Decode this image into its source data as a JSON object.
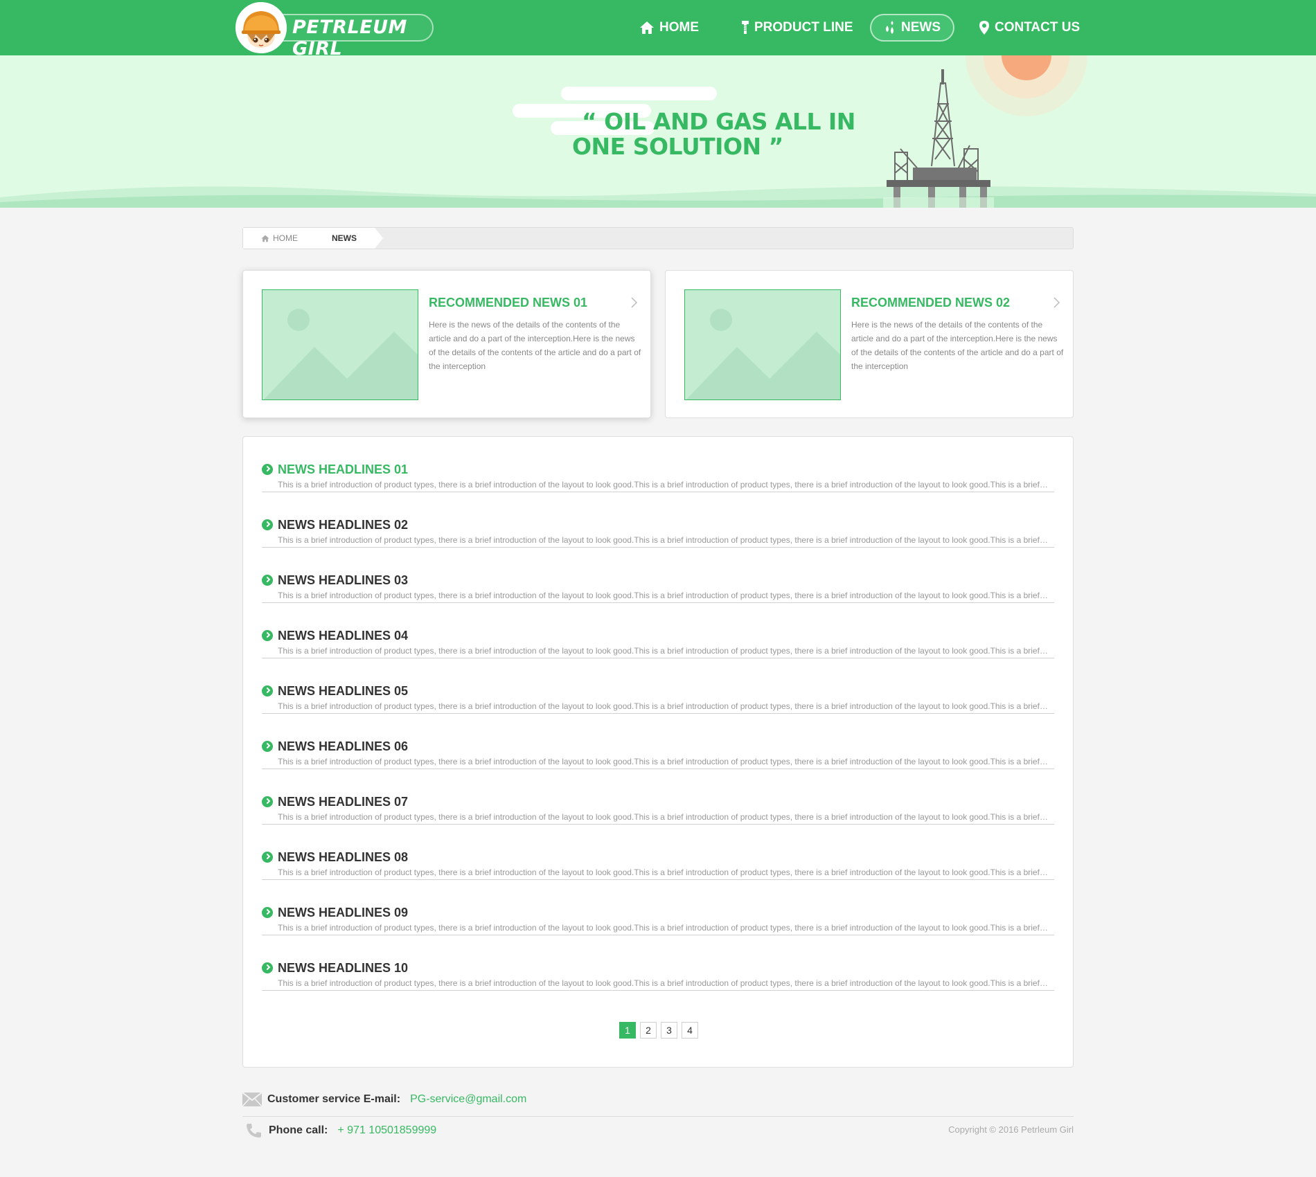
{
  "brand": {
    "name": "PETRLEUM GIRL",
    "accent": "#37b862"
  },
  "nav": {
    "items": [
      {
        "label": "HOME",
        "icon": "home-icon"
      },
      {
        "label": "PRODUCT LINE",
        "icon": "screw-icon"
      },
      {
        "label": "NEWS",
        "icon": "droplets-icon"
      },
      {
        "label": "CONTACT US",
        "icon": "location-pin-icon"
      }
    ],
    "active": "NEWS"
  },
  "banner": {
    "slogan_line1": "“ OIL AND GAS ALL IN",
    "slogan_line2": "ONE SOLUTION ”"
  },
  "breadcrumb": {
    "home": "HOME",
    "current": "NEWS"
  },
  "recommended": [
    {
      "title": "RECOMMENDED NEWS 01",
      "text": "Here is the news of the details of the contents of the article and do a part of the interception.Here is the news of the details of the contents of the article and do a part of the interception"
    },
    {
      "title": "RECOMMENDED NEWS 02",
      "text": "Here is the news of the details of the contents of the article and do a part of the interception.Here is the news of the details of the contents of the article and do a part of the interception"
    }
  ],
  "news": {
    "description": "This is a brief introduction of product types, there is a brief introduction of the layout to look good.This is a brief introduction of product types, there is a brief introduction of the layout to look good.This is a brief introduction of product types",
    "headlines": [
      "NEWS HEADLINES 01",
      "NEWS HEADLINES 02",
      "NEWS HEADLINES 03",
      "NEWS HEADLINES 04",
      "NEWS HEADLINES 05",
      "NEWS HEADLINES 06",
      "NEWS HEADLINES 07",
      "NEWS HEADLINES 08",
      "NEWS HEADLINES 09",
      "NEWS HEADLINES 10"
    ]
  },
  "pagination": {
    "pages": [
      "1",
      "2",
      "3",
      "4"
    ],
    "current": "1"
  },
  "footer": {
    "email_label": "Customer service E-mail:",
    "email": "PG-service@gmail.com",
    "phone_label": "Phone call:",
    "phone": "+ 971 10501859999",
    "copyright": "Copyright  © 2016 Petrleum Girl"
  }
}
